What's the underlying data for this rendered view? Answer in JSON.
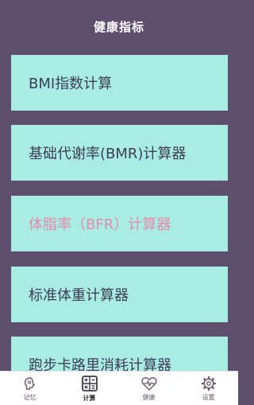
{
  "header": {
    "title": "健康指标"
  },
  "cards": [
    {
      "label": "BMI指数计算",
      "state": "normal"
    },
    {
      "label": "基础代谢率(BMR)计算器",
      "state": "normal"
    },
    {
      "label": "体脂率（BFR）计算器",
      "state": "active"
    },
    {
      "label": "标准体重计算器",
      "state": "normal"
    },
    {
      "label": "跑步卡路里消耗计算器",
      "state": "normal"
    }
  ],
  "tabbar": {
    "selected": "计算",
    "tabs": [
      {
        "label": "记忆",
        "icon": "brain-head-icon"
      },
      {
        "label": "计算",
        "icon": "calculator-icon"
      },
      {
        "label": "健康",
        "icon": "heartbeat-icon"
      },
      {
        "label": "设置",
        "icon": "gear-icon"
      }
    ]
  },
  "colors": {
    "background": "#5e4f6f",
    "card": "#a8ece4",
    "card_text": "#3e3e55",
    "card_active_text": "#e88aa8",
    "header_text": "#ffffff"
  }
}
